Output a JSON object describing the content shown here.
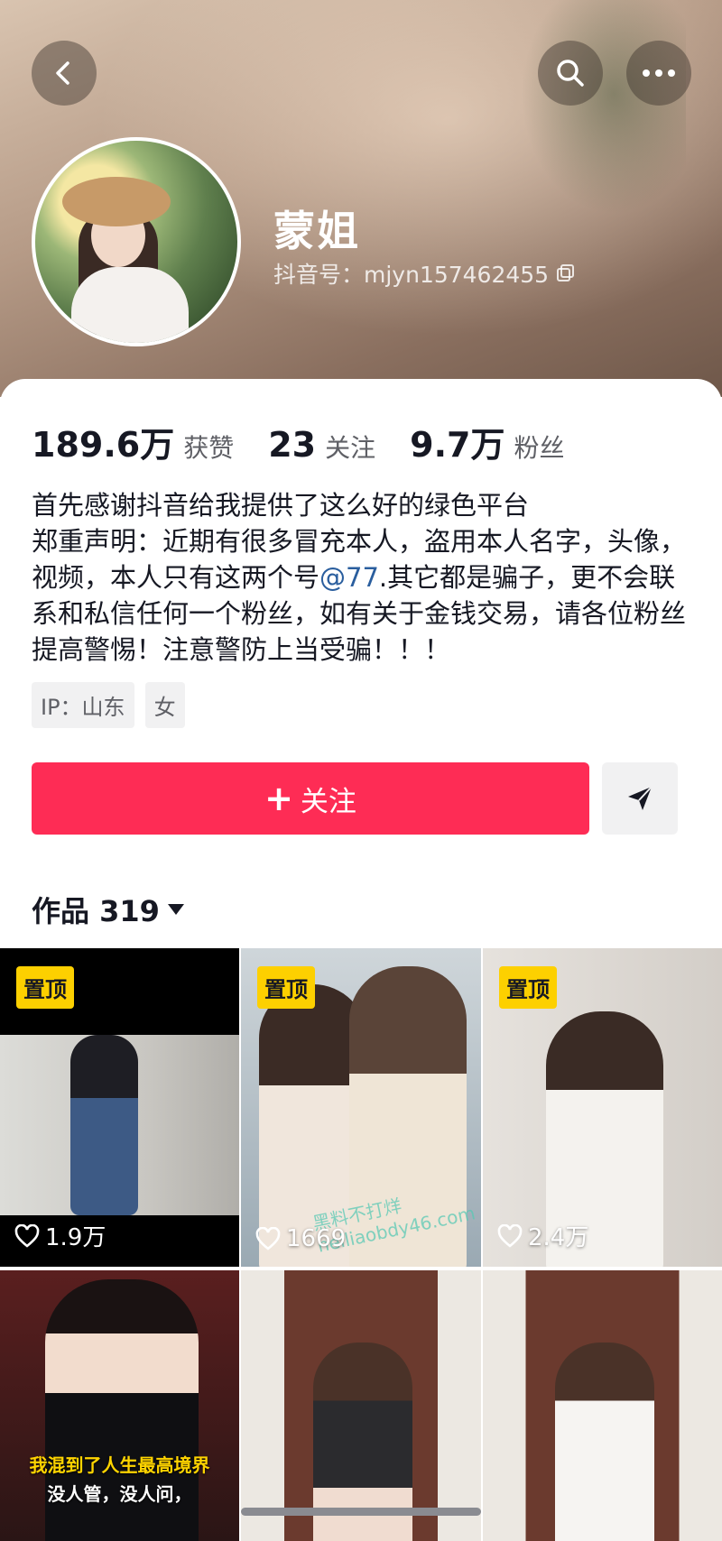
{
  "header": {
    "nickname": "蒙姐",
    "douyin_id": "抖音号：mjyn157462455"
  },
  "icons": {
    "back": "back-arrow-icon",
    "search": "search-icon",
    "more": "more-dots-icon",
    "copy": "copy-icon",
    "share": "send-icon",
    "caret": "caret-down-icon",
    "heart": "heart-icon"
  },
  "stats": [
    {
      "value": "189.6万",
      "label": "获赞"
    },
    {
      "value": "23",
      "label": "关注"
    },
    {
      "value": "9.7万",
      "label": "粉丝"
    }
  ],
  "bio": {
    "line1": "首先感谢抖音给我提供了这么好的绿色平台",
    "line2_before": "郑重声明：近期有很多冒充本人，盗用本人名字，头像，视频，本人只有这两个号",
    "mention": "@77",
    "line2_after": ".其它都是骗子，更不会联系和私信任何一个粉丝，如有关于金钱交易，请各位粉丝提高警惕！注意警防上当受骗！！！"
  },
  "tags": [
    "IP：山东",
    "女"
  ],
  "actions": {
    "follow_label": "关注"
  },
  "works": {
    "tab_label": "作品 319"
  },
  "grid": [
    {
      "pinned": "置顶",
      "likes": "1.9万"
    },
    {
      "pinned": "置顶",
      "likes": "1669",
      "watermark": "黑料不打烊 heiliaobdy46.com"
    },
    {
      "pinned": "置顶",
      "likes": "2.4万"
    },
    {
      "caption1": "我混到了人生最高境界",
      "caption2": "没人管，没人问，"
    },
    {},
    {}
  ],
  "colors": {
    "follow": "#fe2c55",
    "pin": "#fdd000",
    "mention": "#2a5e9e"
  }
}
